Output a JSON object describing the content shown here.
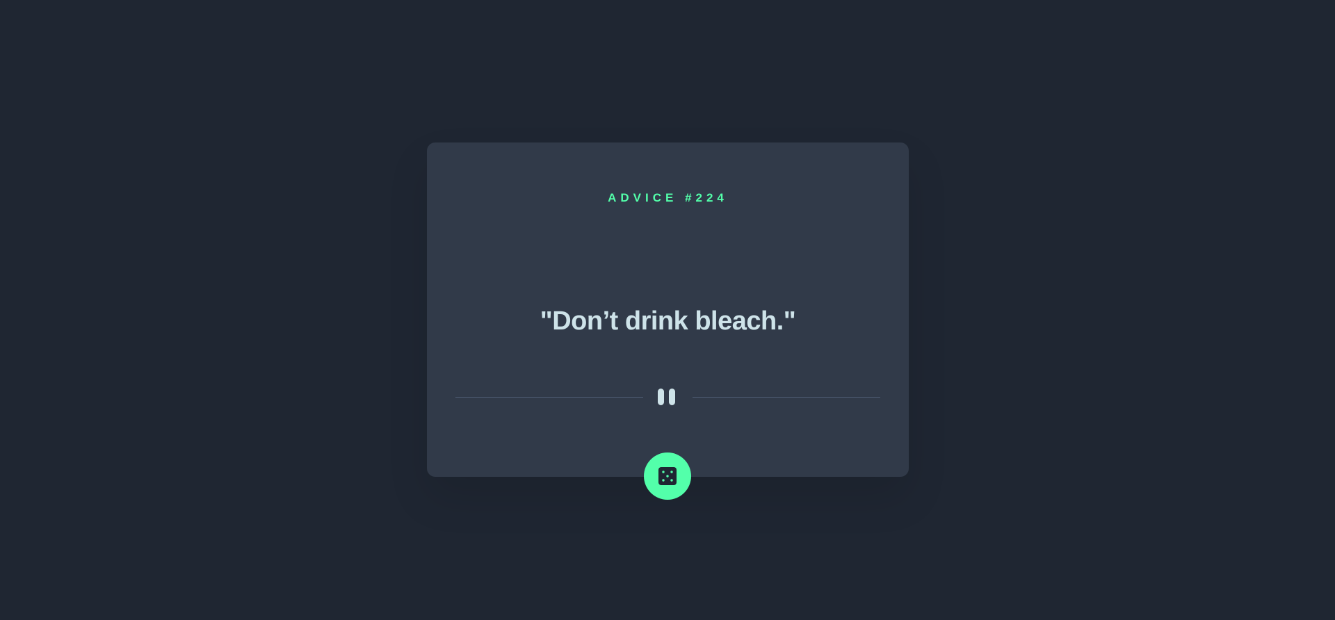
{
  "advice": {
    "label": "ADVICE #224",
    "quote": "\"Don’t drink bleach.\""
  },
  "icons": {
    "divider": "pause-icon",
    "button": "dice-icon"
  },
  "colors": {
    "background": "#1f2632",
    "card": "#313a49",
    "accent": "#53ffaa",
    "text": "#cee3e9",
    "divider": "#4f5d74"
  }
}
